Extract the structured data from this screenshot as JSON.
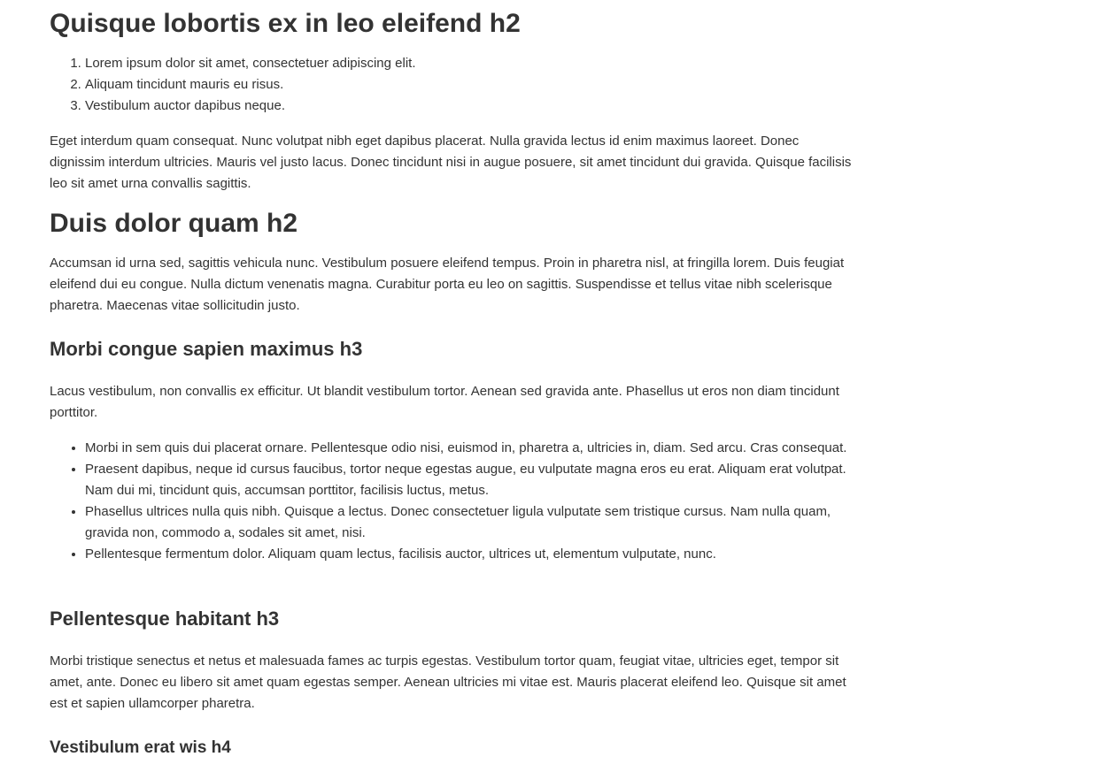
{
  "sections": {
    "heading_1": "Quisque lobortis ex in leo eleifend h2",
    "ordered_list": [
      "Lorem ipsum dolor sit amet, consectetuer adipiscing elit.",
      "Aliquam tincidunt mauris eu risus.",
      "Vestibulum auctor dapibus neque."
    ],
    "paragraph_1": "Eget interdum quam consequat. Nunc volutpat nibh eget dapibus placerat. Nulla gravida lectus id enim maximus laoreet. Donec dignissim interdum ultricies. Mauris vel justo lacus. Donec tincidunt nisi in augue posuere, sit amet tincidunt dui gravida. Quisque facilisis leo sit amet urna convallis sagittis.",
    "heading_2": "Duis dolor quam h2",
    "paragraph_2": "Accumsan id urna sed, sagittis vehicula nunc. Vestibulum posuere eleifend tempus. Proin in pharetra nisl, at fringilla lorem. Duis feugiat eleifend dui eu congue. Nulla dictum venenatis magna. Curabitur porta eu leo on sagittis. Suspendisse et tellus vitae nibh scelerisque pharetra. Maecenas vitae sollicitudin justo.",
    "heading_3": "Morbi congue sapien maximus h3",
    "paragraph_3": "Lacus vestibulum, non convallis ex efficitur. Ut blandit vestibulum tortor. Aenean sed gravida ante. Phasellus ut eros non diam tincidunt porttitor.",
    "bullet_list": [
      "Morbi in sem quis dui placerat ornare. Pellentesque odio nisi, euismod in, pharetra a, ultricies in, diam. Sed arcu. Cras consequat.",
      "Praesent dapibus, neque id cursus faucibus, tortor neque egestas augue, eu vulputate magna eros eu erat. Aliquam erat volutpat. Nam dui mi, tincidunt quis, accumsan porttitor, facilisis luctus, metus.",
      "Phasellus ultrices nulla quis nibh. Quisque a lectus. Donec consectetuer ligula vulputate sem tristique cursus. Nam nulla quam, gravida non, commodo a, sodales sit amet, nisi.",
      "Pellentesque fermentum dolor. Aliquam quam lectus, facilisis auctor, ultrices ut, elementum vulputate, nunc."
    ],
    "heading_4": "Pellentesque habitant h3",
    "paragraph_4": "Morbi tristique senectus et netus et malesuada fames ac turpis egestas. Vestibulum tortor quam, feugiat vitae, ultricies eget, tempor sit amet, ante. Donec eu libero sit amet quam egestas semper. Aenean ultricies mi vitae est. Mauris placerat eleifend leo. Quisque sit amet est et sapien ullamcorper pharetra.",
    "heading_5": "Vestibulum erat wis h4"
  }
}
